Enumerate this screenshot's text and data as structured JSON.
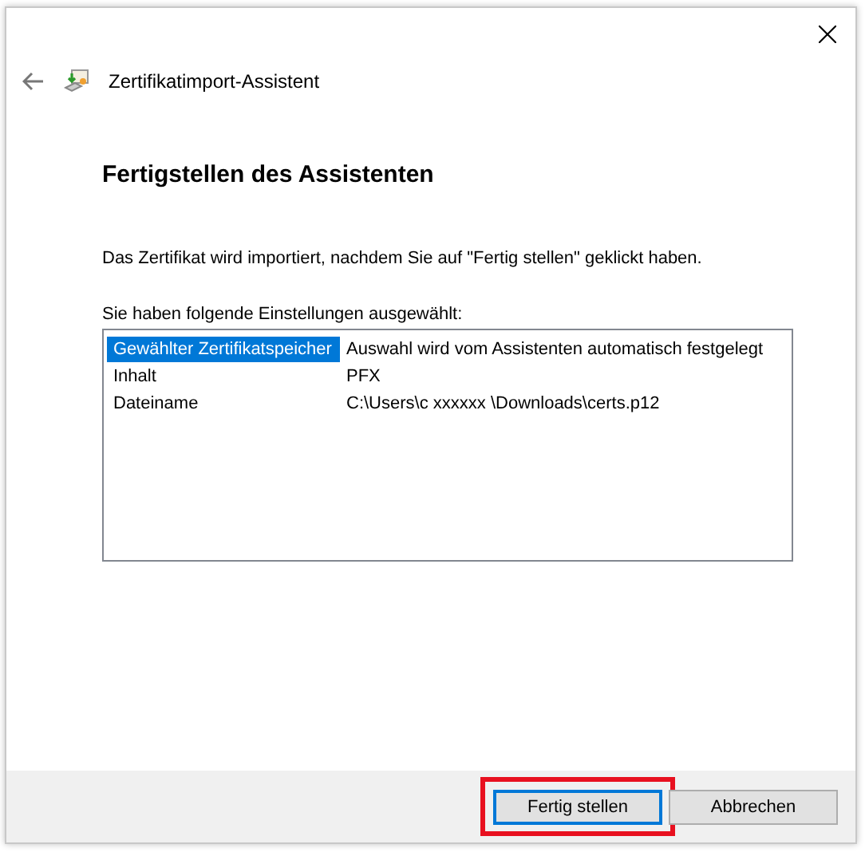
{
  "window": {
    "title": "Zertifikatimport-Assistent"
  },
  "heading": "Fertigstellen des Assistenten",
  "description": "Das Zertifikat wird importiert, nachdem Sie auf \"Fertig stellen\" geklickt haben.",
  "settings": {
    "label": "Sie haben folgende Einstellungen ausgewählt:",
    "rows": [
      {
        "name": "Gewählter Zertifikatspeicher",
        "value": "Auswahl wird vom Assistenten automatisch festgelegt",
        "selected": true
      },
      {
        "name": "Inhalt",
        "value": "PFX",
        "selected": false
      },
      {
        "name": "Dateiname",
        "value": "C:\\Users\\c xxxxxx \\Downloads\\certs.p12",
        "selected": false
      }
    ]
  },
  "buttons": [
    {
      "label": "Fertig stellen",
      "focused": true,
      "highlighted": true
    },
    {
      "label": "Abbrechen",
      "focused": false,
      "highlighted": false
    }
  ]
}
